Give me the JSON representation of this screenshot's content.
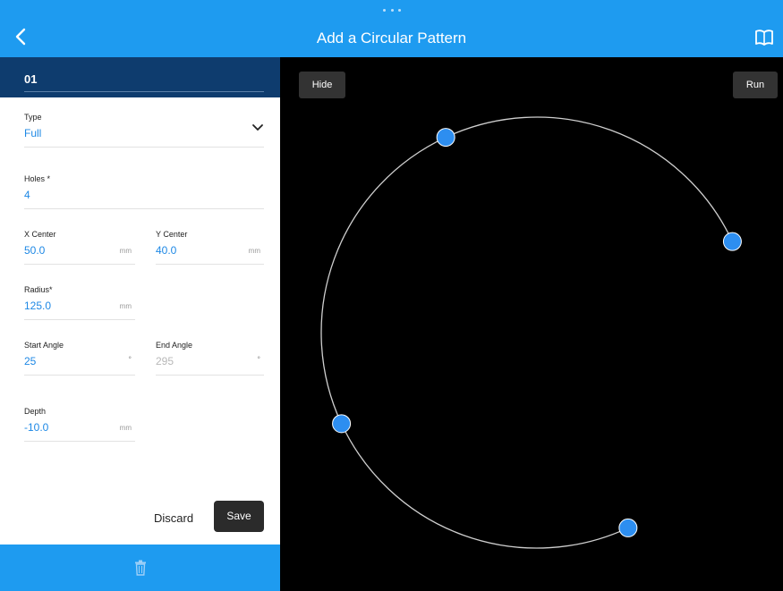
{
  "header": {
    "title": "Add a Circular Pattern",
    "back_icon": "chevron-left-icon",
    "book_icon": "book-icon"
  },
  "panel": {
    "operation_name": "01",
    "fields": {
      "type": {
        "label": "Type",
        "value": "Full"
      },
      "holes": {
        "label": "Holes *",
        "value": "4"
      },
      "x_center": {
        "label": "X Center",
        "value": "50.0",
        "unit": "mm"
      },
      "y_center": {
        "label": "Y Center",
        "value": "40.0",
        "unit": "mm"
      },
      "radius": {
        "label": "Radius*",
        "value": "125.0",
        "unit": "mm"
      },
      "start_angle": {
        "label": "Start Angle",
        "value": "25",
        "unit": "°"
      },
      "end_angle": {
        "label": "End Angle",
        "value": "295",
        "unit": "°"
      },
      "depth": {
        "label": "Depth",
        "value": "-10.0",
        "unit": "mm"
      }
    },
    "discard_label": "Discard",
    "save_label": "Save"
  },
  "footer": {
    "trash_icon": "trash-icon"
  },
  "canvas": {
    "hide_label": "Hide",
    "run_label": "Run",
    "arc_start_angle_deg": 25,
    "arc_end_angle_deg": 295,
    "hole_count": 4
  },
  "colors": {
    "accent": "#1e9bf0",
    "header_dark": "#0e3c6e",
    "value_blue": "#1e88e5",
    "hole_fill": "#2d8ef0"
  }
}
